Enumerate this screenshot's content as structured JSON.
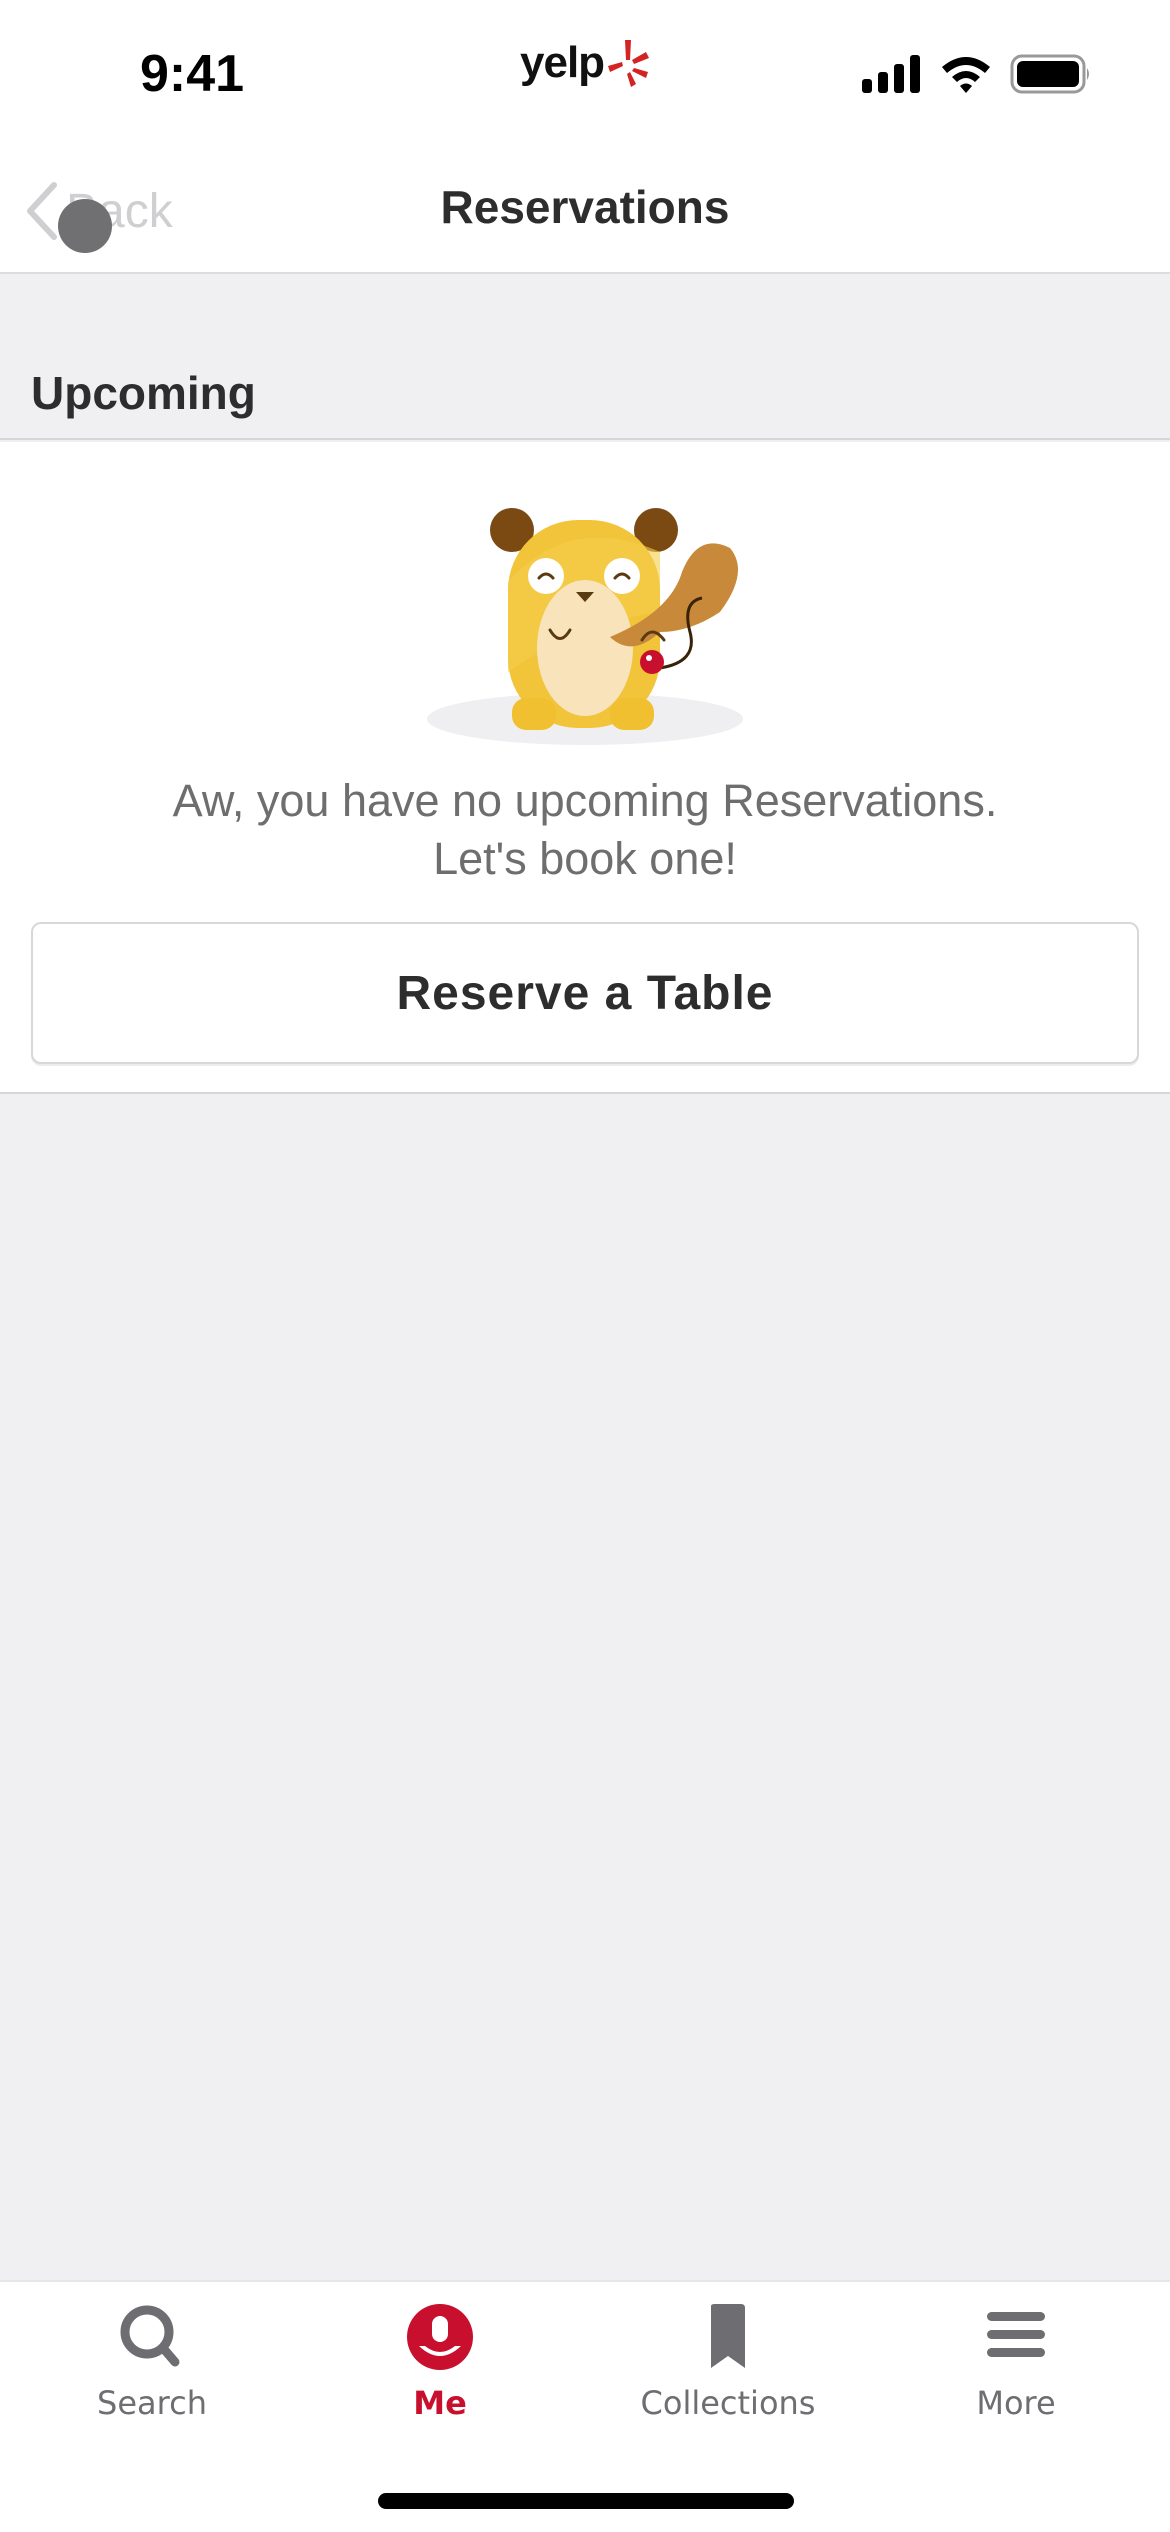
{
  "status_bar": {
    "time": "9:41",
    "logo_text": "yelp",
    "icons": [
      "cellular-signal-icon",
      "wifi-icon",
      "battery-icon"
    ]
  },
  "nav": {
    "back_label": "Back",
    "title": "Reservations"
  },
  "section": {
    "title": "Upcoming"
  },
  "empty_state": {
    "illustration": "hamster-mascot-with-paddle-ball",
    "message_line1": "Aw, you have no upcoming Reservations.",
    "message_line2": "Let's book one!",
    "button_label": "Reserve a Table"
  },
  "tab_bar": {
    "items": [
      {
        "label": "Search",
        "icon": "search-icon",
        "active": false
      },
      {
        "label": "Me",
        "icon": "user-icon",
        "active": true
      },
      {
        "label": "Collections",
        "icon": "bookmark-icon",
        "active": false
      },
      {
        "label": "More",
        "icon": "menu-icon",
        "active": false
      }
    ]
  },
  "colors": {
    "brand_red": "#c8102e",
    "inactive_gray": "#6e6e72",
    "background": "#f0eff2"
  }
}
